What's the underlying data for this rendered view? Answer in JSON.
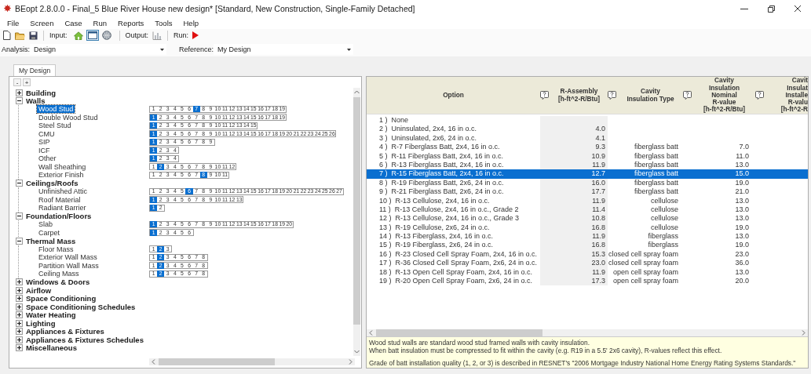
{
  "window": {
    "title": "BEopt 2.8.0.0 - Final_5 Blue River House new design* [Standard, New Construction, Single-Family Detached]"
  },
  "menu": [
    "File",
    "Screen",
    "Case",
    "Run",
    "Reports",
    "Tools",
    "Help"
  ],
  "toolbar": {
    "input_label": "Input:",
    "inputs": [
      {
        "kind": "home",
        "selected": false
      },
      {
        "kind": "window",
        "selected": true
      },
      {
        "kind": "globe",
        "selected": false
      }
    ],
    "output_label": "Output:",
    "output_disabled": true,
    "run_label": "Run:"
  },
  "analysis": {
    "label": "Analysis:",
    "value": "Design",
    "reference_label": "Reference:",
    "reference_value": "My Design"
  },
  "tabs": [
    {
      "label": "My Design",
      "selected": true
    }
  ],
  "tree": {
    "buttons": [
      "-",
      "+"
    ],
    "categories": [
      {
        "label": "Building",
        "expanded": false
      },
      {
        "label": "Walls",
        "expanded": true,
        "children": [
          {
            "label": "Wood Stud",
            "selected": true,
            "options": [
              {
                "label": "1",
                "selected": false
              },
              {
                "label": "2",
                "selected": false
              },
              {
                "label": "3",
                "selected": false
              },
              {
                "label": "4",
                "selected": false
              },
              {
                "label": "5",
                "selected": false
              },
              {
                "label": "6",
                "selected": false
              },
              {
                "label": "7",
                "selected": true
              },
              {
                "label": "8",
                "selected": false
              },
              {
                "label": "9",
                "selected": false
              },
              {
                "label": "10",
                "selected": false
              },
              {
                "label": "11",
                "selected": false
              },
              {
                "label": "12",
                "selected": false
              },
              {
                "label": "13",
                "selected": false
              },
              {
                "label": "14",
                "selected": false
              },
              {
                "label": "15",
                "selected": false
              },
              {
                "label": "16",
                "selected": false
              },
              {
                "label": "17",
                "selected": false
              },
              {
                "label": "18",
                "selected": false
              },
              {
                "label": "19",
                "selected": false
              }
            ]
          },
          {
            "label": "Double Wood Stud",
            "selected": false,
            "options": [
              {
                "label": "1",
                "selected": true
              },
              {
                "label": "2",
                "selected": false
              },
              {
                "label": "3",
                "selected": false
              },
              {
                "label": "4",
                "selected": false
              },
              {
                "label": "5",
                "selected": false
              },
              {
                "label": "6",
                "selected": false
              },
              {
                "label": "7",
                "selected": false
              },
              {
                "label": "8",
                "selected": false
              },
              {
                "label": "9",
                "selected": false
              },
              {
                "label": "10",
                "selected": false
              },
              {
                "label": "11",
                "selected": false
              },
              {
                "label": "12",
                "selected": false
              },
              {
                "label": "13",
                "selected": false
              },
              {
                "label": "14",
                "selected": false
              },
              {
                "label": "15",
                "selected": false
              },
              {
                "label": "16",
                "selected": false
              },
              {
                "label": "17",
                "selected": false
              },
              {
                "label": "18",
                "selected": false
              },
              {
                "label": "19",
                "selected": false
              }
            ]
          },
          {
            "label": "Steel Stud",
            "selected": false,
            "options": [
              {
                "label": "1",
                "selected": true
              },
              {
                "label": "2",
                "selected": false
              },
              {
                "label": "3",
                "selected": false
              },
              {
                "label": "4",
                "selected": false
              },
              {
                "label": "5",
                "selected": false
              },
              {
                "label": "6",
                "selected": false
              },
              {
                "label": "7",
                "selected": false
              },
              {
                "label": "8",
                "selected": false
              },
              {
                "label": "9",
                "selected": false
              },
              {
                "label": "10",
                "selected": false
              },
              {
                "label": "11",
                "selected": false
              },
              {
                "label": "12",
                "selected": false
              },
              {
                "label": "13",
                "selected": false
              },
              {
                "label": "14",
                "selected": false
              },
              {
                "label": "15",
                "selected": false
              }
            ]
          },
          {
            "label": "CMU",
            "selected": false,
            "options": [
              {
                "label": "1",
                "selected": true
              },
              {
                "label": "2",
                "selected": false
              },
              {
                "label": "3",
                "selected": false
              },
              {
                "label": "4",
                "selected": false
              },
              {
                "label": "5",
                "selected": false
              },
              {
                "label": "6",
                "selected": false
              },
              {
                "label": "7",
                "selected": false
              },
              {
                "label": "8",
                "selected": false
              },
              {
                "label": "9",
                "selected": false
              },
              {
                "label": "10",
                "selected": false
              },
              {
                "label": "11",
                "selected": false
              },
              {
                "label": "12",
                "selected": false
              },
              {
                "label": "13",
                "selected": false
              },
              {
                "label": "14",
                "selected": false
              },
              {
                "label": "15",
                "selected": false
              },
              {
                "label": "16",
                "selected": false
              },
              {
                "label": "17",
                "selected": false
              },
              {
                "label": "18",
                "selected": false
              },
              {
                "label": "19",
                "selected": false
              },
              {
                "label": "20",
                "selected": false
              },
              {
                "label": "21",
                "selected": false
              },
              {
                "label": "22",
                "selected": false
              },
              {
                "label": "23",
                "selected": false
              },
              {
                "label": "24",
                "selected": false
              },
              {
                "label": "25",
                "selected": false
              },
              {
                "label": "26",
                "selected": false
              }
            ]
          },
          {
            "label": "SIP",
            "selected": false,
            "options": [
              {
                "label": "1",
                "selected": true
              },
              {
                "label": "2",
                "selected": false
              },
              {
                "label": "3",
                "selected": false
              },
              {
                "label": "4",
                "selected": false
              },
              {
                "label": "5",
                "selected": false
              },
              {
                "label": "6",
                "selected": false
              },
              {
                "label": "7",
                "selected": false
              },
              {
                "label": "8",
                "selected": false
              },
              {
                "label": "9",
                "selected": false
              }
            ]
          },
          {
            "label": "ICF",
            "selected": false,
            "options": [
              {
                "label": "1",
                "selected": true
              },
              {
                "label": "2",
                "selected": false
              },
              {
                "label": "3",
                "selected": false
              },
              {
                "label": "4",
                "selected": false
              }
            ]
          },
          {
            "label": "Other",
            "selected": false,
            "options": [
              {
                "label": "1",
                "selected": true
              },
              {
                "label": "2",
                "selected": false
              },
              {
                "label": "3",
                "selected": false
              },
              {
                "label": "4",
                "selected": false
              }
            ]
          },
          {
            "label": "Wall Sheathing",
            "selected": false,
            "options": [
              {
                "label": "1",
                "selected": false
              },
              {
                "label": "2",
                "selected": true
              },
              {
                "label": "3",
                "selected": false
              },
              {
                "label": "4",
                "selected": false
              },
              {
                "label": "5",
                "selected": false
              },
              {
                "label": "6",
                "selected": false
              },
              {
                "label": "7",
                "selected": false
              },
              {
                "label": "8",
                "selected": false
              },
              {
                "label": "9",
                "selected": false
              },
              {
                "label": "10",
                "selected": false
              },
              {
                "label": "11",
                "selected": false
              },
              {
                "label": "12",
                "selected": false
              }
            ]
          },
          {
            "label": "Exterior Finish",
            "selected": false,
            "options": [
              {
                "label": "1",
                "selected": false
              },
              {
                "label": "2",
                "selected": false
              },
              {
                "label": "3",
                "selected": false
              },
              {
                "label": "4",
                "selected": false
              },
              {
                "label": "5",
                "selected": false
              },
              {
                "label": "6",
                "selected": false
              },
              {
                "label": "7",
                "selected": false
              },
              {
                "label": "8",
                "selected": true
              },
              {
                "label": "9",
                "selected": false
              },
              {
                "label": "10",
                "selected": false
              },
              {
                "label": "11",
                "selected": false
              }
            ]
          }
        ]
      },
      {
        "label": "Ceilings/Roofs",
        "expanded": true,
        "children": [
          {
            "label": "Unfinished Attic",
            "selected": false,
            "options": [
              {
                "label": "1",
                "selected": false
              },
              {
                "label": "2",
                "selected": false
              },
              {
                "label": "3",
                "selected": false
              },
              {
                "label": "4",
                "selected": false
              },
              {
                "label": "5",
                "selected": false
              },
              {
                "label": "6",
                "selected": true
              },
              {
                "label": "7",
                "selected": false
              },
              {
                "label": "8",
                "selected": false
              },
              {
                "label": "9",
                "selected": false
              },
              {
                "label": "10",
                "selected": false
              },
              {
                "label": "11",
                "selected": false
              },
              {
                "label": "12",
                "selected": false
              },
              {
                "label": "13",
                "selected": false
              },
              {
                "label": "14",
                "selected": false
              },
              {
                "label": "15",
                "selected": false
              },
              {
                "label": "16",
                "selected": false
              },
              {
                "label": "17",
                "selected": false
              },
              {
                "label": "18",
                "selected": false
              },
              {
                "label": "19",
                "selected": false
              },
              {
                "label": "20",
                "selected": false
              },
              {
                "label": "21",
                "selected": false
              },
              {
                "label": "22",
                "selected": false
              },
              {
                "label": "23",
                "selected": false
              },
              {
                "label": "24",
                "selected": false
              },
              {
                "label": "25",
                "selected": false
              },
              {
                "label": "26",
                "selected": false
              },
              {
                "label": "27",
                "selected": false
              }
            ]
          },
          {
            "label": "Roof Material",
            "selected": false,
            "options": [
              {
                "label": "1",
                "selected": true
              },
              {
                "label": "2",
                "selected": false
              },
              {
                "label": "3",
                "selected": false
              },
              {
                "label": "4",
                "selected": false
              },
              {
                "label": "5",
                "selected": false
              },
              {
                "label": "6",
                "selected": false
              },
              {
                "label": "7",
                "selected": false
              },
              {
                "label": "8",
                "selected": false
              },
              {
                "label": "9",
                "selected": false
              },
              {
                "label": "10",
                "selected": false
              },
              {
                "label": "11",
                "selected": false
              },
              {
                "label": "12",
                "selected": false
              },
              {
                "label": "13",
                "selected": false
              }
            ]
          },
          {
            "label": "Radiant Barrier",
            "selected": false,
            "options": [
              {
                "label": "1",
                "selected": true
              },
              {
                "label": "2",
                "selected": false
              }
            ]
          }
        ]
      },
      {
        "label": "Foundation/Floors",
        "expanded": true,
        "children": [
          {
            "label": "Slab",
            "selected": false,
            "options": [
              {
                "label": "1",
                "selected": true
              },
              {
                "label": "2",
                "selected": false
              },
              {
                "label": "3",
                "selected": false
              },
              {
                "label": "4",
                "selected": false
              },
              {
                "label": "5",
                "selected": false
              },
              {
                "label": "6",
                "selected": false
              },
              {
                "label": "7",
                "selected": false
              },
              {
                "label": "8",
                "selected": false
              },
              {
                "label": "9",
                "selected": false
              },
              {
                "label": "10",
                "selected": false
              },
              {
                "label": "11",
                "selected": false
              },
              {
                "label": "12",
                "selected": false
              },
              {
                "label": "13",
                "selected": false
              },
              {
                "label": "14",
                "selected": false
              },
              {
                "label": "15",
                "selected": false
              },
              {
                "label": "16",
                "selected": false
              },
              {
                "label": "17",
                "selected": false
              },
              {
                "label": "18",
                "selected": false
              },
              {
                "label": "19",
                "selected": false
              },
              {
                "label": "20",
                "selected": false
              }
            ]
          },
          {
            "label": "Carpet",
            "selected": false,
            "options": [
              {
                "label": "1",
                "selected": true
              },
              {
                "label": "2",
                "selected": false
              },
              {
                "label": "3",
                "selected": false
              },
              {
                "label": "4",
                "selected": false
              },
              {
                "label": "5",
                "selected": false
              },
              {
                "label": "6",
                "selected": false
              }
            ]
          }
        ]
      },
      {
        "label": "Thermal Mass",
        "expanded": true,
        "children": [
          {
            "label": "Floor Mass",
            "selected": false,
            "options": [
              {
                "label": "1",
                "selected": false
              },
              {
                "label": "2",
                "selected": true
              },
              {
                "label": "3",
                "selected": false
              }
            ]
          },
          {
            "label": "Exterior Wall Mass",
            "selected": false,
            "options": [
              {
                "label": "1",
                "selected": false
              },
              {
                "label": "2",
                "selected": true
              },
              {
                "label": "3",
                "selected": false
              },
              {
                "label": "4",
                "selected": false
              },
              {
                "label": "5",
                "selected": false
              },
              {
                "label": "6",
                "selected": false
              },
              {
                "label": "7",
                "selected": false
              },
              {
                "label": "8",
                "selected": false
              }
            ]
          },
          {
            "label": "Partition Wall Mass",
            "selected": false,
            "options": [
              {
                "label": "1",
                "selected": false
              },
              {
                "label": "2",
                "selected": true
              },
              {
                "label": "3",
                "selected": false
              },
              {
                "label": "4",
                "selected": false
              },
              {
                "label": "5",
                "selected": false
              },
              {
                "label": "6",
                "selected": false
              },
              {
                "label": "7",
                "selected": false
              },
              {
                "label": "8",
                "selected": false
              }
            ]
          },
          {
            "label": "Ceiling Mass",
            "selected": false,
            "options": [
              {
                "label": "1",
                "selected": false
              },
              {
                "label": "2",
                "selected": true
              },
              {
                "label": "3",
                "selected": false
              },
              {
                "label": "4",
                "selected": false
              },
              {
                "label": "5",
                "selected": false
              },
              {
                "label": "6",
                "selected": false
              },
              {
                "label": "7",
                "selected": false
              },
              {
                "label": "8",
                "selected": false
              }
            ]
          }
        ]
      },
      {
        "label": "Windows & Doors",
        "expanded": false
      },
      {
        "label": "Airflow",
        "expanded": false
      },
      {
        "label": "Space Conditioning",
        "expanded": false
      },
      {
        "label": "Space Conditioning Schedules",
        "expanded": false
      },
      {
        "label": "Water Heating",
        "expanded": false
      },
      {
        "label": "Lighting",
        "expanded": false
      },
      {
        "label": "Appliances & Fixtures",
        "expanded": false
      },
      {
        "label": "Appliances & Fixtures Schedules",
        "expanded": false
      },
      {
        "label": "Miscellaneous",
        "expanded": false
      }
    ]
  },
  "table": {
    "columns": [
      {
        "label": "Option",
        "help": false
      },
      {
        "label": "R-Assembly\n[h-ft^2-R/Btu]",
        "help": true
      },
      {
        "label": "Cavity\nInsulation Type",
        "help": true
      },
      {
        "label": "Cavity\nInsulation\nNominal\nR-value\n[h-ft^2-R/Btu]",
        "help": true
      },
      {
        "label": "Cavit\nInsulat\nInstalle\nR-valu\n[h-ft^2-R",
        "help": true
      }
    ],
    "rows": [
      {
        "number": "1 )",
        "option": "None",
        "selected": false
      },
      {
        "number": "2 )",
        "option": "Uninsulated, 2x4, 16 in o.c.",
        "r_assembly": "4.0",
        "selected": false
      },
      {
        "number": "3 )",
        "option": "Uninsulated, 2x6, 24 in o.c.",
        "r_assembly": "4.1",
        "selected": false
      },
      {
        "number": "4 )",
        "option": "R-7 Fiberglass Batt, 2x4, 16 in o.c.",
        "r_assembly": "9.3",
        "cavity_type": "fiberglass batt",
        "nominal": "7.0",
        "selected": false
      },
      {
        "number": "5 )",
        "option": "R-11 Fiberglass Batt, 2x4, 16 in o.c.",
        "r_assembly": "10.9",
        "cavity_type": "fiberglass batt",
        "nominal": "11.0",
        "selected": false
      },
      {
        "number": "6 )",
        "option": "R-13 Fiberglass Batt, 2x4, 16 in o.c.",
        "r_assembly": "11.9",
        "cavity_type": "fiberglass batt",
        "nominal": "13.0",
        "selected": false
      },
      {
        "number": "7 )",
        "option": "R-15 Fiberglass Batt, 2x4, 16 in o.c.",
        "r_assembly": "12.7",
        "cavity_type": "fiberglass batt",
        "nominal": "15.0",
        "selected": true
      },
      {
        "number": "8 )",
        "option": "R-19 Fiberglass Batt, 2x6, 24 in o.c.",
        "r_assembly": "16.0",
        "cavity_type": "fiberglass batt",
        "nominal": "19.0",
        "selected": false
      },
      {
        "number": "9 )",
        "option": "R-21 Fiberglass Batt, 2x6, 24 in o.c.",
        "r_assembly": "17.7",
        "cavity_type": "fiberglass batt",
        "nominal": "21.0",
        "selected": false
      },
      {
        "number": "10 )",
        "option": "R-13 Cellulose, 2x4, 16 in o.c.",
        "r_assembly": "11.9",
        "cavity_type": "cellulose",
        "nominal": "13.0",
        "selected": false
      },
      {
        "number": "11 )",
        "option": "R-13 Cellulose, 2x4, 16 in o.c., Grade 2",
        "r_assembly": "11.4",
        "cavity_type": "cellulose",
        "nominal": "13.0",
        "selected": false
      },
      {
        "number": "12 )",
        "option": "R-13 Cellulose, 2x4, 16 in o.c., Grade 3",
        "r_assembly": "10.8",
        "cavity_type": "cellulose",
        "nominal": "13.0",
        "selected": false
      },
      {
        "number": "13 )",
        "option": "R-19 Cellulose, 2x6, 24 in o.c.",
        "r_assembly": "16.8",
        "cavity_type": "cellulose",
        "nominal": "19.0",
        "selected": false
      },
      {
        "number": "14 )",
        "option": "R-13 Fiberglass, 2x4, 16 in o.c.",
        "r_assembly": "11.9",
        "cavity_type": "fiberglass",
        "nominal": "13.0",
        "selected": false
      },
      {
        "number": "15 )",
        "option": "R-19 Fiberglass, 2x6, 24 in o.c.",
        "r_assembly": "16.8",
        "cavity_type": "fiberglass",
        "nominal": "19.0",
        "selected": false
      },
      {
        "number": "16 )",
        "option": "R-23 Closed Cell Spray Foam, 2x4, 16 in o.c.",
        "r_assembly": "15.3",
        "cavity_type": "closed cell spray foam",
        "nominal": "23.0",
        "selected": false
      },
      {
        "number": "17 )",
        "option": "R-36 Closed Cell Spray Foam, 2x6, 24 in o.c.",
        "r_assembly": "23.0",
        "cavity_type": "closed cell spray foam",
        "nominal": "36.0",
        "selected": false
      },
      {
        "number": "18 )",
        "option": "R-13 Open Cell Spray Foam, 2x4, 16 in o.c.",
        "r_assembly": "11.9",
        "cavity_type": "open cell spray foam",
        "nominal": "13.0",
        "selected": false
      },
      {
        "number": "19 )",
        "option": "R-20 Open Cell Spray Foam, 2x6, 24 in o.c.",
        "r_assembly": "17.3",
        "cavity_type": "open cell spray foam",
        "nominal": "20.0",
        "selected": false
      }
    ]
  },
  "description": [
    "Wood stud walls are standard wood stud framed walls with cavity insulation.",
    "When batt insulation must be compressed to fit within the cavity (e.g. R19 in a 5.5' 2x6 cavity), R-values reflect this effect.",
    "Grade of batt installation quality (1, 2, or 3) is described in RESNET's \"2006 Mortgage Industry National Home Energy Rating Systems Standards.\""
  ]
}
